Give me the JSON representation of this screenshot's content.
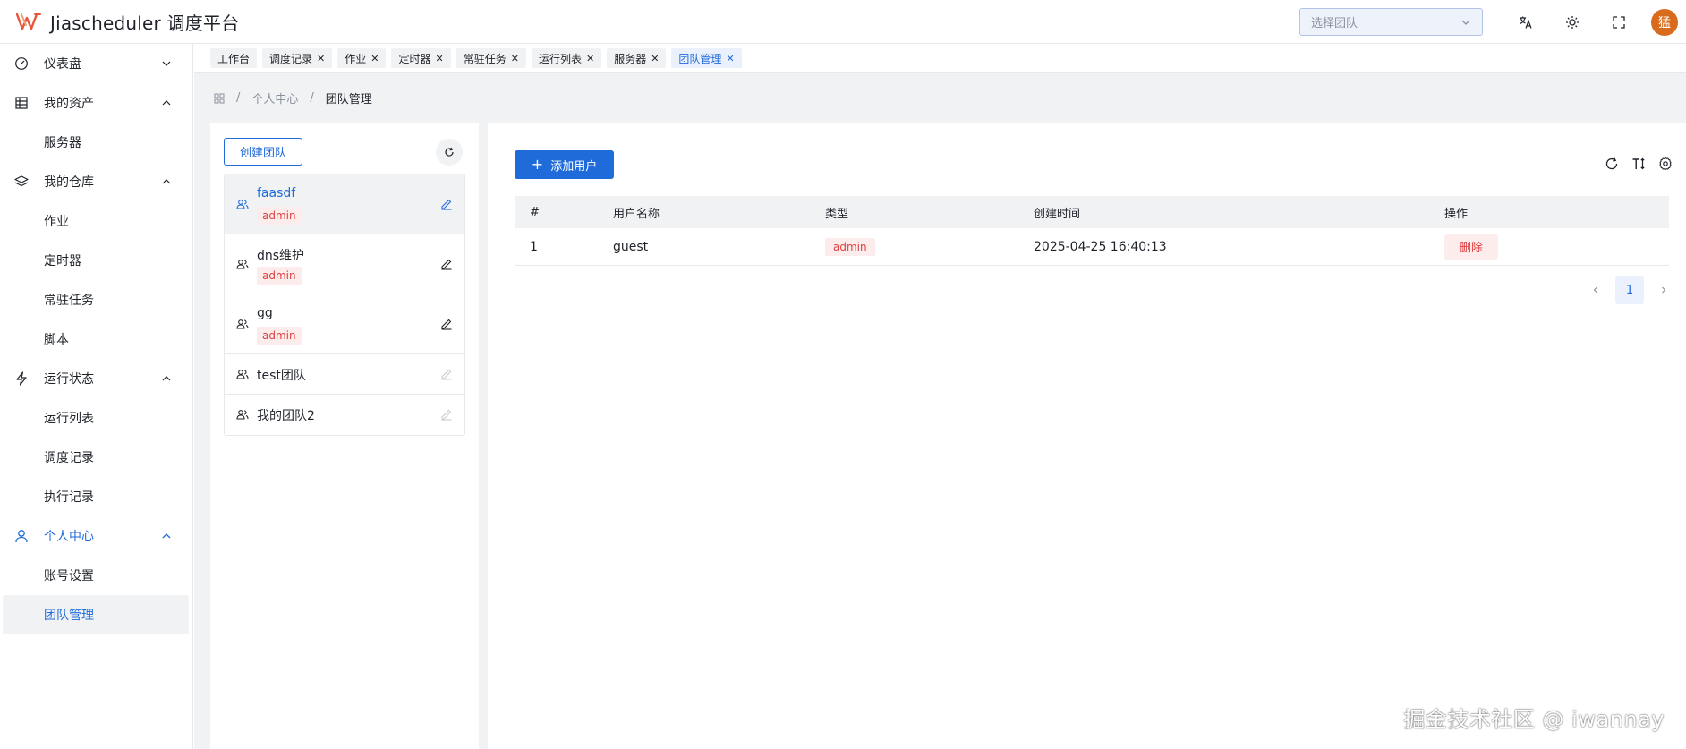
{
  "app": {
    "title": "Jiascheduler 调度平台"
  },
  "header": {
    "team_select_placeholder": "选择团队",
    "avatar_text": "猛"
  },
  "sidebar": {
    "groups": [
      {
        "label": "仪表盘",
        "icon": "dashboard-icon",
        "expanded": false,
        "items": []
      },
      {
        "label": "我的资产",
        "icon": "asset-icon",
        "expanded": true,
        "items": [
          "服务器"
        ]
      },
      {
        "label": "我的仓库",
        "icon": "layers-icon",
        "expanded": true,
        "items": [
          "作业",
          "定时器",
          "常驻任务",
          "脚本"
        ]
      },
      {
        "label": "运行状态",
        "icon": "lightning-icon",
        "expanded": true,
        "items": [
          "运行列表",
          "调度记录",
          "执行记录"
        ]
      },
      {
        "label": "个人中心",
        "icon": "user-icon",
        "expanded": true,
        "active": true,
        "items": [
          "账号设置",
          "团队管理"
        ]
      }
    ],
    "selected_item": "团队管理"
  },
  "tabs": [
    {
      "label": "工作台",
      "closable": false
    },
    {
      "label": "调度记录",
      "closable": true
    },
    {
      "label": "作业",
      "closable": true
    },
    {
      "label": "定时器",
      "closable": true
    },
    {
      "label": "常驻任务",
      "closable": true
    },
    {
      "label": "运行列表",
      "closable": true
    },
    {
      "label": "服务器",
      "closable": true
    },
    {
      "label": "团队管理",
      "closable": true,
      "active": true
    }
  ],
  "breadcrumb": {
    "items": [
      "个人中心",
      "团队管理"
    ]
  },
  "team_panel": {
    "create_label": "创建团队",
    "teams": [
      {
        "name": "faasdf",
        "badge": "admin",
        "selected": true,
        "editable": true
      },
      {
        "name": "dns维护",
        "badge": "admin",
        "selected": false,
        "editable": true
      },
      {
        "name": "gg",
        "badge": "admin",
        "selected": false,
        "editable": true
      },
      {
        "name": "test团队",
        "badge": "",
        "selected": false,
        "editable": false
      },
      {
        "name": "我的团队2",
        "badge": "",
        "selected": false,
        "editable": false
      }
    ]
  },
  "member_panel": {
    "add_label": "添加用户",
    "columns": [
      "#",
      "用户名称",
      "类型",
      "创建时间",
      "操作"
    ],
    "rows": [
      {
        "index": "1",
        "username": "guest",
        "type": "admin",
        "created": "2025-04-25 16:40:13",
        "action": "删除"
      }
    ],
    "pagination": {
      "current": "1"
    }
  },
  "watermark": "掘金技术社区 @ iwannay",
  "colors": {
    "primary": "#1f6bda",
    "danger": "#e0403f",
    "danger_bg": "#fdecec",
    "bg_gray": "#f1f2f4"
  }
}
